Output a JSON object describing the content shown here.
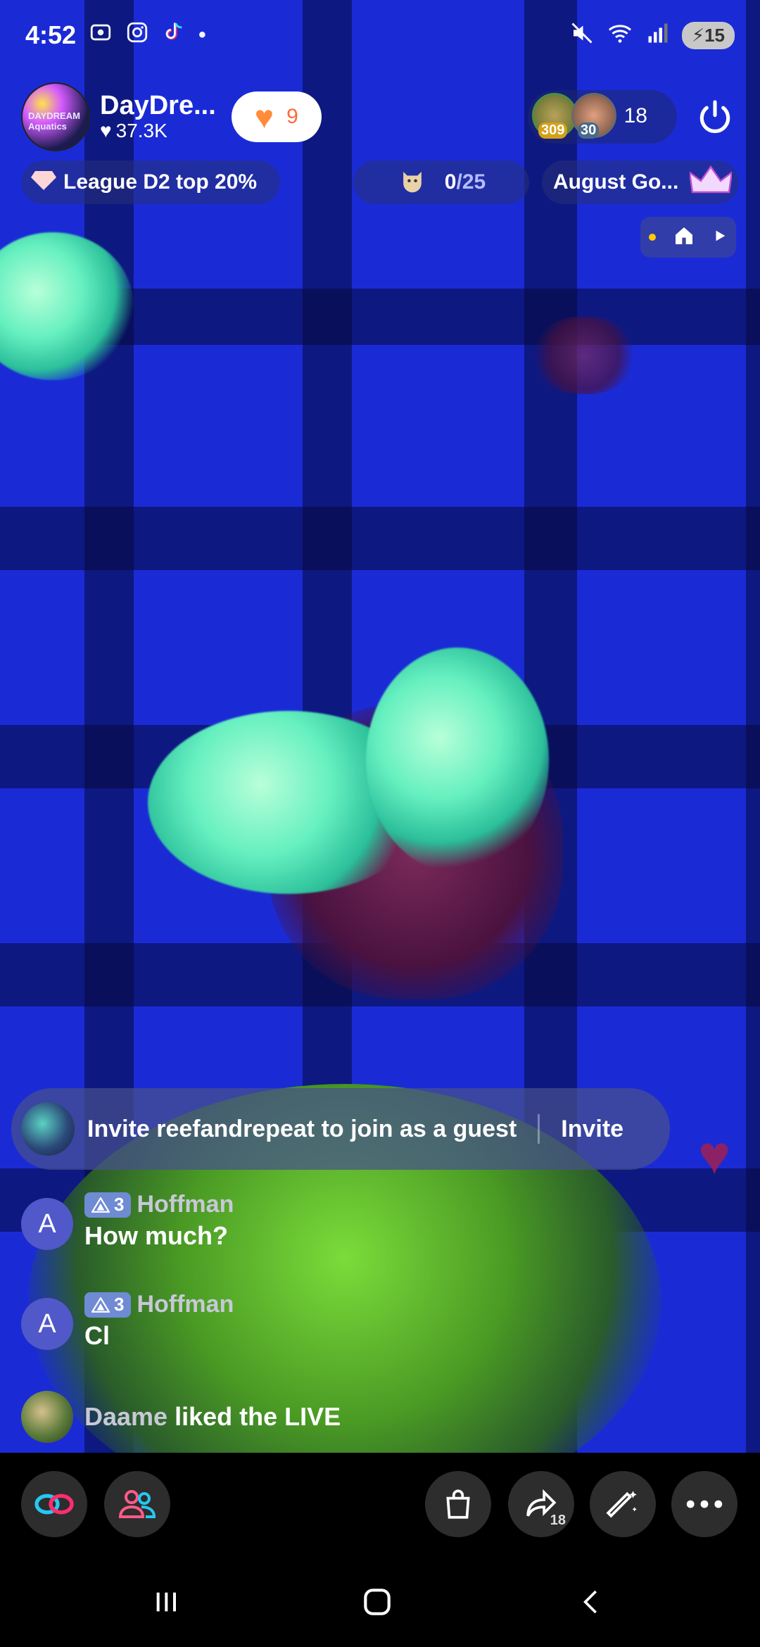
{
  "status_bar": {
    "time": "4:52",
    "app_icons": [
      "screenshot-icon",
      "instagram-icon",
      "tiktok-icon",
      "dot-icon"
    ],
    "right_icons": [
      "mute-icon",
      "wifi-icon",
      "signal-icon"
    ],
    "battery": "15"
  },
  "host": {
    "name": "DayDre...",
    "logo_text": "DAYDREAM Aquatics",
    "followers": "37.3K",
    "likes": "9"
  },
  "viewers": {
    "badges": [
      "309",
      "30"
    ],
    "count": "18"
  },
  "info": {
    "league": "League D2 top 20%",
    "goal_current": "0",
    "goal_total": "/25",
    "august": "August Go..."
  },
  "invite": {
    "text": "Invite reefandrepeat to join as a guest",
    "button": "Invite"
  },
  "chat": [
    {
      "avatar": "A",
      "level": "3",
      "user": "Hoffman",
      "message": "How much?"
    },
    {
      "avatar": "A",
      "level": "3",
      "user": "Hoffman",
      "message": "Cl"
    }
  ],
  "system_message": {
    "user": "Daame",
    "text": "liked the LIVE"
  },
  "toolbar": {
    "share_count": "18"
  },
  "colors": {
    "accent": "#ff6a3a",
    "level_badge": "#6f8bd4",
    "avatar_purple": "#5158c9",
    "tank_blue": "#1a2bd6"
  }
}
